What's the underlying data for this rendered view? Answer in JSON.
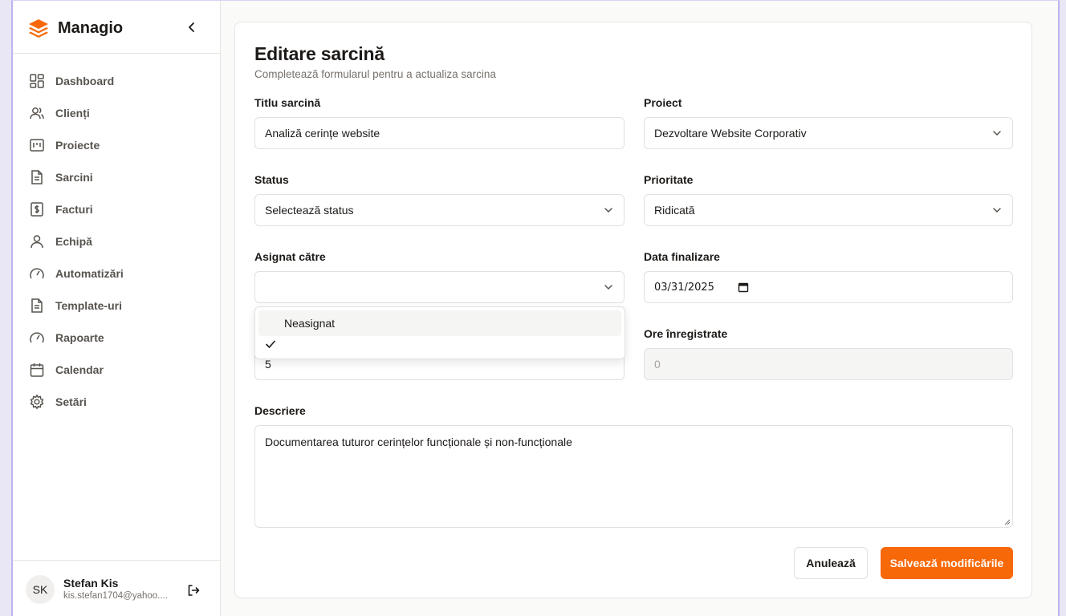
{
  "app": {
    "name": "Managio",
    "accent": "#f76808"
  },
  "sidebar": {
    "items": [
      {
        "label": "Dashboard",
        "icon": "dashboard-icon"
      },
      {
        "label": "Clienți",
        "icon": "users-icon"
      },
      {
        "label": "Proiecte",
        "icon": "project-icon"
      },
      {
        "label": "Sarcini",
        "icon": "file-icon"
      },
      {
        "label": "Facturi",
        "icon": "invoice-icon"
      },
      {
        "label": "Echipă",
        "icon": "user-icon"
      },
      {
        "label": "Automatizări",
        "icon": "gauge-icon"
      },
      {
        "label": "Template-uri",
        "icon": "file-icon"
      },
      {
        "label": "Rapoarte",
        "icon": "gauge-icon"
      },
      {
        "label": "Calendar",
        "icon": "calendar-icon"
      },
      {
        "label": "Setări",
        "icon": "gear-icon"
      }
    ]
  },
  "user": {
    "initials": "SK",
    "name": "Stefan Kis",
    "email": "kis.stefan1704@yahoo...."
  },
  "form": {
    "title": "Editare sarcină",
    "subtitle": "Completează formularul pentru a actualiza sarcina",
    "task_title": {
      "label": "Titlu sarcină",
      "value": "Analiză cerințe website"
    },
    "project": {
      "label": "Proiect",
      "value": "Dezvoltare Website Corporativ"
    },
    "status": {
      "label": "Status",
      "value": "Selectează status"
    },
    "priority": {
      "label": "Prioritate",
      "value": "Ridicată"
    },
    "assignee": {
      "label": "Asignat către",
      "value": ""
    },
    "due_date": {
      "label": "Data finalizare",
      "value": "03/31/2025"
    },
    "estimated_hours": {
      "value": "5"
    },
    "logged_hours": {
      "label": "Ore înregistrate",
      "value": "0"
    },
    "description": {
      "label": "Descriere",
      "value": "Documentarea tuturor cerințelor funcționale și non-funcționale"
    },
    "cancel_label": "Anulează",
    "save_label": "Salvează modificările"
  },
  "dropdown": {
    "options": [
      {
        "label": "Neasignat",
        "highlighted": true,
        "checked": false
      },
      {
        "label": "",
        "highlighted": false,
        "checked": true
      }
    ]
  }
}
